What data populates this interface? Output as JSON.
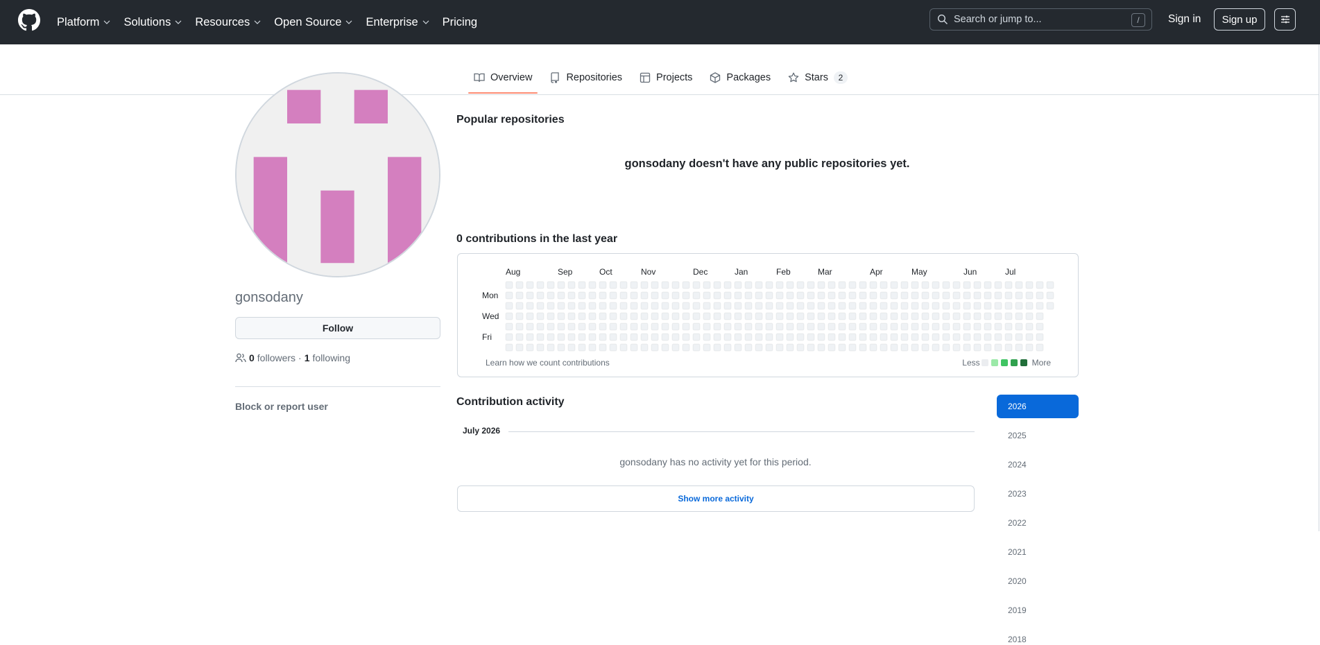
{
  "header": {
    "logo_icon": "github-mark-icon",
    "nav": [
      {
        "label": "Platform",
        "dropdown": true
      },
      {
        "label": "Solutions",
        "dropdown": true
      },
      {
        "label": "Resources",
        "dropdown": true
      },
      {
        "label": "Open Source",
        "dropdown": true
      },
      {
        "label": "Enterprise",
        "dropdown": true
      },
      {
        "label": "Pricing",
        "dropdown": false
      }
    ],
    "search_placeholder": "Search or jump to...",
    "search_shortcut": "/",
    "sign_in": "Sign in",
    "sign_up": "Sign up"
  },
  "tabs": [
    {
      "label": "Overview",
      "icon": "book-icon",
      "active": true
    },
    {
      "label": "Repositories",
      "icon": "repo-icon"
    },
    {
      "label": "Projects",
      "icon": "table-icon"
    },
    {
      "label": "Packages",
      "icon": "package-icon"
    },
    {
      "label": "Stars",
      "icon": "star-icon",
      "count": "2"
    }
  ],
  "profile": {
    "username": "gonsodany",
    "follow_label": "Follow",
    "followers_count": "0",
    "followers_label": "followers",
    "separator": "·",
    "following_count": "1",
    "following_label": "following",
    "block_label": "Block or report user",
    "avatar_color": "#d47fbf"
  },
  "main": {
    "popular_title": "Popular repositories",
    "no_repos_text": "gonsodany doesn't have any public repositories yet.",
    "contrib_title": "0 contributions in the last year"
  },
  "calendar": {
    "months": [
      "Aug",
      "Sep",
      "Oct",
      "Nov",
      "Dec",
      "Jan",
      "Feb",
      "Mar",
      "Apr",
      "May",
      "Jun",
      "Jul"
    ],
    "days": [
      "Mon",
      "Wed",
      "Fri"
    ],
    "weeks": 53,
    "contribution_count": 0,
    "learn_text": "Learn how we count contributions",
    "legend_less": "Less",
    "legend_more": "More",
    "legend_colors": [
      "#ebedf0",
      "#9be9a8",
      "#40c463",
      "#30a14e",
      "#216e39"
    ],
    "empty_color": "#eff2f5"
  },
  "activity": {
    "title": "Contribution activity",
    "month_label": "July 2026",
    "empty_text": "gonsodany has no activity yet for this period.",
    "more_button": "Show more activity"
  },
  "years": [
    {
      "label": "2026",
      "active": true
    },
    {
      "label": "2025"
    },
    {
      "label": "2024"
    },
    {
      "label": "2023"
    },
    {
      "label": "2022"
    },
    {
      "label": "2021"
    },
    {
      "label": "2020"
    },
    {
      "label": "2019"
    },
    {
      "label": "2018"
    }
  ]
}
